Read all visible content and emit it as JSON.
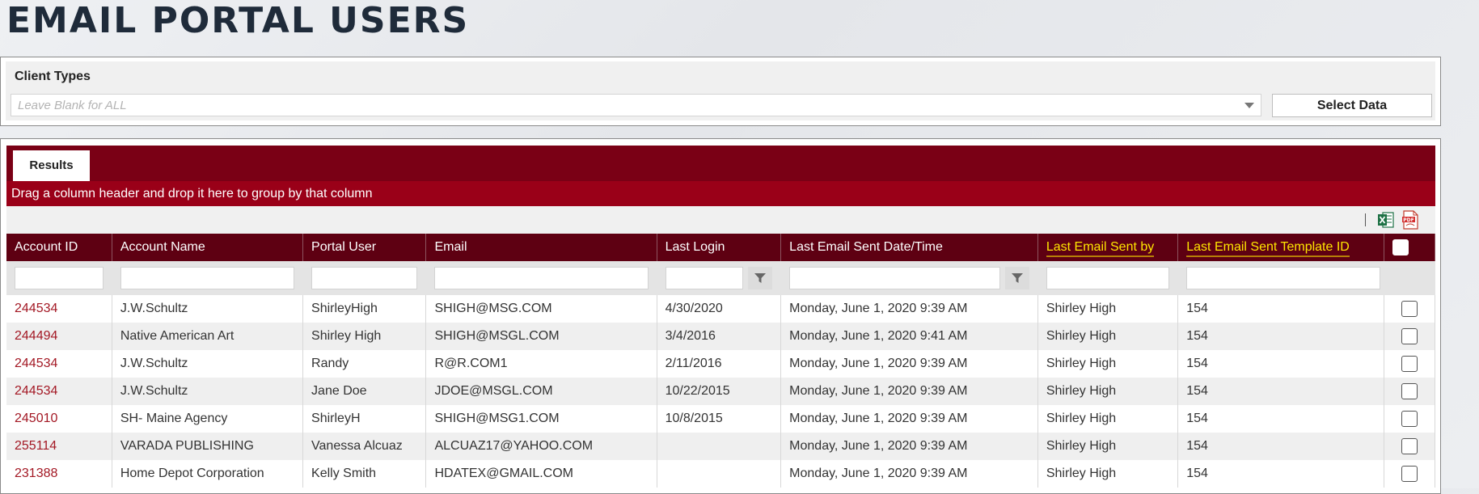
{
  "page_title": "EMAIL PORTAL USERS",
  "filters": {
    "client_types_label": "Client Types",
    "client_types_placeholder": "Leave Blank for ALL",
    "select_data_label": "Select Data"
  },
  "results": {
    "tab_label": "Results",
    "group_hint": "Drag a column header and drop it here to group by that column",
    "toolbar_separator": "|",
    "columns": [
      "Account ID",
      "Account Name",
      "Portal User",
      "Email",
      "Last Login",
      "Last Email Sent Date/Time",
      "Last Email Sent by",
      "Last Email Sent Template ID"
    ],
    "highlight_color": "#ffe600",
    "rows": [
      {
        "account_id": "244534",
        "account_name": "J.W.Schultz",
        "portal_user": "ShirleyHigh",
        "email": "SHIGH@MSG.COM",
        "last_login": "4/30/2020",
        "last_sent": "Monday, June 1, 2020 9:39 AM",
        "sent_by": "Shirley High",
        "template_id": "154"
      },
      {
        "account_id": "244494",
        "account_name": "Native American Art",
        "portal_user": "Shirley High",
        "email": "SHIGH@MSGL.COM",
        "last_login": "3/4/2016",
        "last_sent": "Monday, June 1, 2020 9:41 AM",
        "sent_by": "Shirley High",
        "template_id": "154"
      },
      {
        "account_id": "244534",
        "account_name": "J.W.Schultz",
        "portal_user": "Randy",
        "email": "R@R.COM1",
        "last_login": "2/11/2016",
        "last_sent": "Monday, June 1, 2020 9:39 AM",
        "sent_by": "Shirley High",
        "template_id": "154"
      },
      {
        "account_id": "244534",
        "account_name": "J.W.Schultz",
        "portal_user": "Jane Doe",
        "email": "JDOE@MSGL.COM",
        "last_login": "10/22/2015",
        "last_sent": "Monday, June 1, 2020 9:39 AM",
        "sent_by": "Shirley High",
        "template_id": "154"
      },
      {
        "account_id": "245010",
        "account_name": "SH- Maine Agency",
        "portal_user": "ShirleyH",
        "email": "SHIGH@MSG1.COM",
        "last_login": "10/8/2015",
        "last_sent": "Monday, June 1, 2020 9:39 AM",
        "sent_by": "Shirley High",
        "template_id": "154"
      },
      {
        "account_id": "255114",
        "account_name": "VARADA PUBLISHING",
        "portal_user": "Vanessa Alcuaz",
        "email": "ALCUAZ17@YAHOO.COM",
        "last_login": "",
        "last_sent": "Monday, June 1, 2020 9:39 AM",
        "sent_by": "Shirley High",
        "template_id": "154"
      },
      {
        "account_id": "231388",
        "account_name": "Home Depot Corporation",
        "portal_user": "Kelly Smith",
        "email": "HDATEX@GMAIL.COM",
        "last_login": "",
        "last_sent": "Monday, June 1, 2020 9:39 AM",
        "sent_by": "Shirley High",
        "template_id": "154"
      }
    ]
  },
  "icons": {
    "excel": "excel-export-icon",
    "pdf": "pdf-export-icon",
    "filter": "filter-icon",
    "dropdown": "chevron-down-icon"
  },
  "colors": {
    "tab_bar": "#7a0015",
    "group_bar": "#9a0018",
    "header": "#5e0012",
    "account_link": "#a31824"
  }
}
